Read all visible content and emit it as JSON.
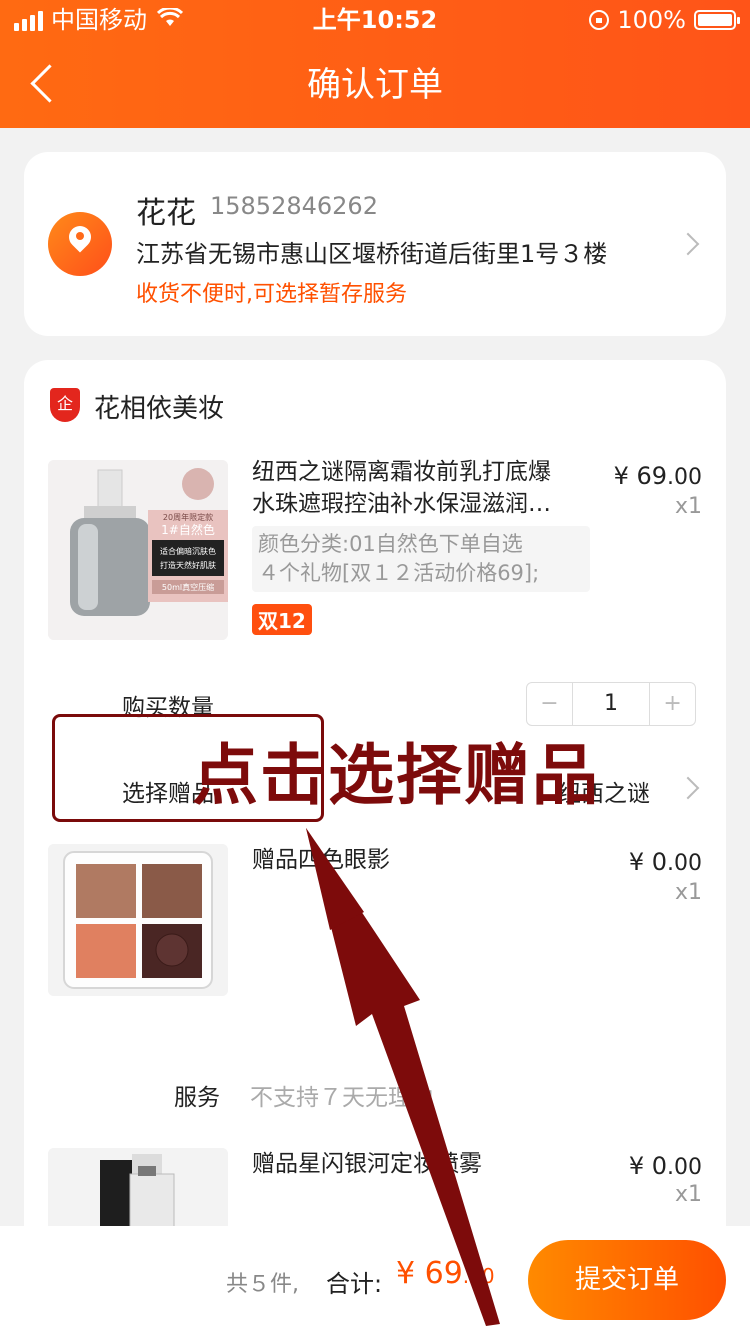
{
  "status_bar": {
    "carrier": "中国移动",
    "time": "上午10:52",
    "battery": "100%"
  },
  "header": {
    "title": "确认订单"
  },
  "address": {
    "name": "花花",
    "phone": "15852846262",
    "detail": "江苏省无锡市惠山区堰桥街道后街里1号３楼",
    "tip": "收货不便时,可选择暂存服务"
  },
  "shop": {
    "badge_icon": "企",
    "name": "花相依美妆",
    "product": {
      "title_line1": "纽西之谜隔离霜妆前乳打底爆",
      "title_line2": "水珠遮瑕控油补水保湿滋润…",
      "price": "¥ 69",
      "price_decimal": ".00",
      "qty": "x1",
      "spec_line1": "颜色分类:01自然色下单自选",
      "spec_line2": "４个礼物[双１２活动价格69];",
      "badge": "双12",
      "image_text_1": "20周年限定款",
      "image_text_2": "1#自然色",
      "image_text_3": "适合偏暗沉肤色",
      "image_text_4": "打造天然好肌肤",
      "image_text_5": "50ml真空压缩"
    },
    "quantity_label": "购买数量",
    "quantity_value": "1",
    "minus": "−",
    "plus": "+",
    "gift_label": "选择赠品",
    "gift_value": "纽西之谜",
    "gift1": {
      "title": "赠品四色眼影",
      "price": "¥ 0",
      "price_decimal": ".00",
      "qty": "x1"
    },
    "service_label": "服务",
    "service_value": "不支持７天无理由",
    "gift2": {
      "title": "赠品星闪银河定妆喷雾",
      "price": "¥ 0",
      "price_decimal": ".00",
      "qty": "x1"
    }
  },
  "annotation": {
    "text": "点击选择赠品"
  },
  "footer": {
    "count": "共５件,",
    "total_label": "合计:",
    "total_value": "¥ 69",
    "total_decimal": ".00",
    "submit": "提交订单"
  },
  "colors": {
    "accent": "#ff5000",
    "header": "#ff6a12",
    "annotation": "#7d0b0b"
  }
}
